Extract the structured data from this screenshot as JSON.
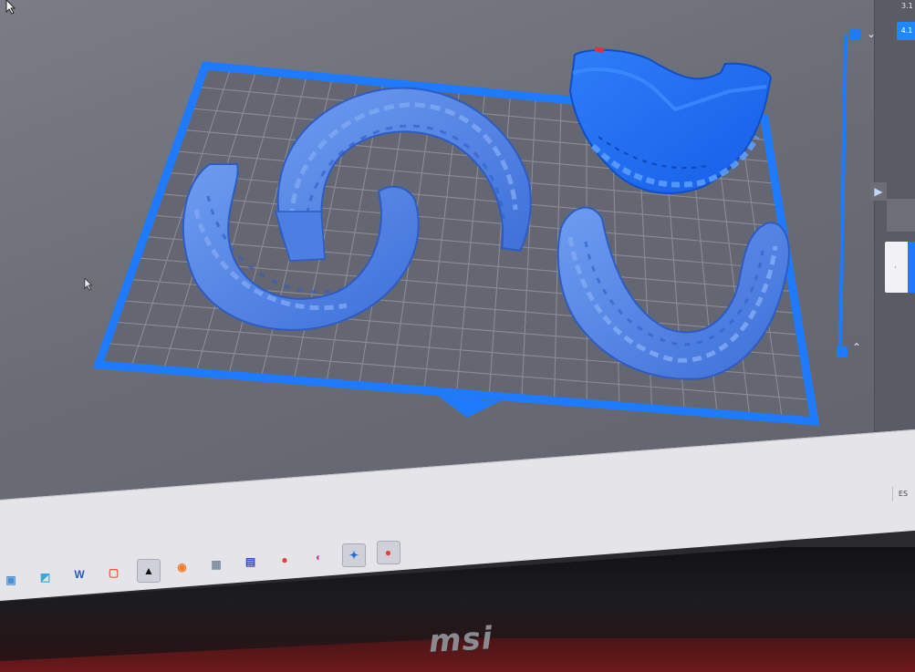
{
  "app": {
    "layer_top": "3.1",
    "layer_current": "4.1"
  },
  "icons": {
    "layer_up": "chevron-down-icon",
    "layer_down": "chevron-up-icon",
    "panel_play": "play-icon"
  },
  "taskbar": {
    "language": "ES",
    "apps": [
      {
        "name": "presentation-app-icon",
        "color": "#4a8fd6",
        "glyph": "▣"
      },
      {
        "name": "notes-app-icon",
        "color": "#3aa7d9",
        "glyph": "◩"
      },
      {
        "name": "word-app-icon",
        "color": "#2b5bb8",
        "glyph": "W"
      },
      {
        "name": "image-viewer-app-icon",
        "color": "#e35b3b",
        "glyph": "▢"
      },
      {
        "name": "slicer-app-icon",
        "color": "#111111",
        "glyph": "▲",
        "active": true
      },
      {
        "name": "camera-app-icon",
        "color": "#f07a2a",
        "glyph": "◉"
      },
      {
        "name": "calculator-app-icon",
        "color": "#7d8da3",
        "glyph": "▦"
      },
      {
        "name": "save-app-icon",
        "color": "#2a4cc0",
        "glyph": "▤"
      },
      {
        "name": "chrome-app-icon",
        "color": "#db4437",
        "glyph": "●"
      },
      {
        "name": "paint-app-icon",
        "color": "#c23fa0",
        "glyph": "◐"
      },
      {
        "name": "blue-diamond-app-icon",
        "color": "#1f6fe0",
        "glyph": "✦",
        "active": true
      },
      {
        "name": "chrome-app-icon-2",
        "color": "#db4437",
        "glyph": "●",
        "active": true
      }
    ]
  },
  "bezel": {
    "brand": "msi"
  },
  "colors": {
    "accent": "#1e7bff",
    "model": "#4f83e8",
    "model_selected": "#1d6cf5",
    "viewport_bg": "#6c6e78"
  }
}
